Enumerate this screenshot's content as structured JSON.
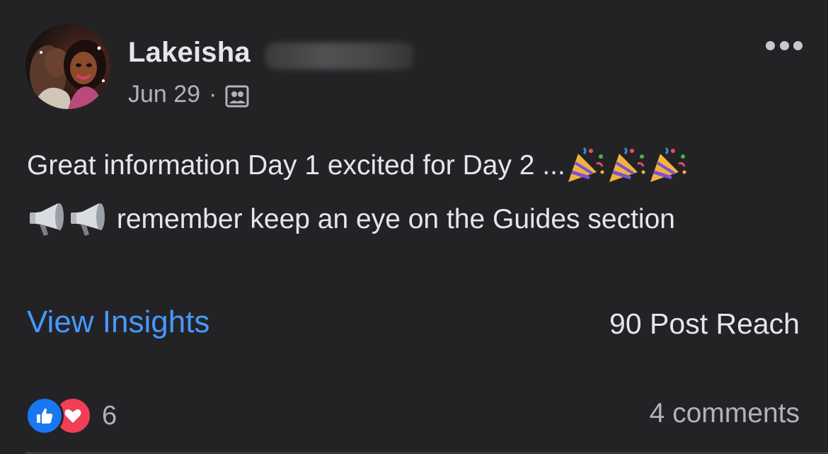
{
  "post": {
    "author_name": "Lakeisha",
    "date": "Jun 29",
    "separator": "·",
    "audience_icon": "group-audience-icon",
    "text_line1": "Great information Day 1 excited for Day 2 ...",
    "text_line1_emojis": [
      "party-popper-icon",
      "party-popper-icon",
      "party-popper-icon"
    ],
    "text_line2_emojis": [
      "megaphone-icon",
      "megaphone-icon"
    ],
    "text_line2": "remember keep an eye on the Guides section"
  },
  "insights": {
    "view_label": "View Insights",
    "reach_label": "90 Post Reach"
  },
  "footer": {
    "reaction_icons": [
      "like-icon",
      "love-icon"
    ],
    "reaction_count": "6",
    "comments_label": "4 comments"
  },
  "colors": {
    "background": "#232325",
    "primary_text": "#e4e6eb",
    "secondary_text": "#b0b3b8",
    "link": "#4599ff",
    "like": "#1877f2",
    "love": "#f33e58"
  }
}
